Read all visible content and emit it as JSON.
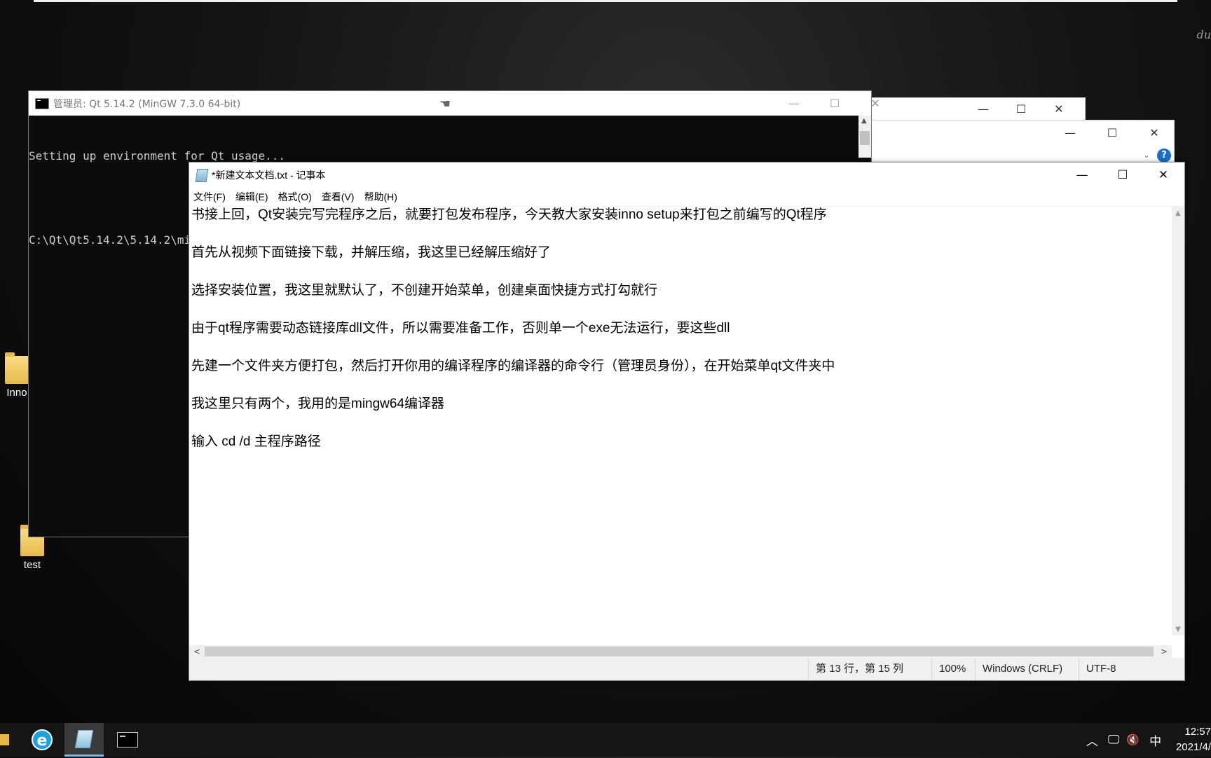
{
  "desktop": {
    "corner_text": "du",
    "icons": [
      {
        "label": "Inno"
      },
      {
        "label": "test"
      }
    ]
  },
  "console": {
    "title": "管理员: Qt 5.14.2 (MinGW 7.3.0 64-bit)",
    "lines": [
      "Setting up environment for Qt usage...",
      "",
      "C:\\Qt\\Qt5.14.2\\5.14.2\\mingw73_64>"
    ]
  },
  "notepad": {
    "title": "*新建文本文档.txt - 记事本",
    "menu": [
      "文件(F)",
      "编辑(E)",
      "格式(O)",
      "查看(V)",
      "帮助(H)"
    ],
    "lines": [
      "书接上回，Qt安装完写完程序之后，就要打包发布程序，今天教大家安装inno setup来打包之前编写的Qt程序",
      "首先从视频下面链接下载，并解压缩，我这里已经解压缩好了",
      "选择安装位置，我这里就默认了，不创建开始菜单，创建桌面快捷方式打勾就行",
      "由于qt程序需要动态链接库dll文件，所以需要准备工作，否则单一个exe无法运行，要这些dll",
      "先建一个文件夹方便打包，然后打开你用的编译程序的编译器的命令行（管理员身份），在开始菜单qt文件夹中",
      "我这里只有两个，我用的是mingw64编译器",
      "输入 cd /d 主程序路径"
    ],
    "status": {
      "position": "第 13 行，第 15 列",
      "zoom": "100%",
      "line_ending": "Windows (CRLF)",
      "encoding": "UTF-8"
    }
  },
  "taskbar": {
    "apps": [
      "file-explorer-icon",
      "ie-browser-icon",
      "notepad-icon",
      "cmd-icon"
    ],
    "ime": "中",
    "time": "12:57",
    "date": "2021/4/"
  }
}
